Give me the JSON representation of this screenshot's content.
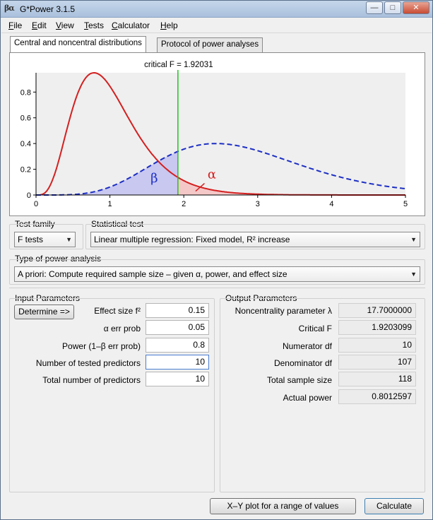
{
  "window": {
    "icon_text": "βα",
    "title": "G*Power 3.1.5",
    "minimize": "—",
    "maximize": "□",
    "close": "✕"
  },
  "menu": {
    "items": [
      {
        "mnemonic": "F",
        "rest": "ile"
      },
      {
        "mnemonic": "E",
        "rest": "dit"
      },
      {
        "mnemonic": "V",
        "rest": "iew"
      },
      {
        "mnemonic": "T",
        "rest": "ests"
      },
      {
        "mnemonic": "C",
        "rest": "alculator"
      },
      {
        "mnemonic": "H",
        "rest": "elp"
      }
    ]
  },
  "tabs": [
    {
      "label": "Central and noncentral distributions"
    },
    {
      "label": "Protocol of power analyses"
    }
  ],
  "chart_data": {
    "type": "line",
    "title": "critical F = 1.92031",
    "xlim": [
      0,
      5
    ],
    "ylim": [
      0,
      0.95
    ],
    "x_ticks": [
      "0",
      "1",
      "2",
      "3",
      "4",
      "5"
    ],
    "y_ticks": [
      "0",
      "0.2",
      "0.4",
      "0.6",
      "0.8"
    ],
    "critical_f": 1.92031,
    "series": [
      {
        "role": "central",
        "dist": "F",
        "df1": 10,
        "df2": 107,
        "color": "#d42020",
        "dash": "solid",
        "peak_x": 0.78,
        "peak_y": 0.95
      },
      {
        "role": "noncentral",
        "dist": "noncentral F",
        "df1": 10,
        "df2": 107,
        "lambda": 17.7,
        "color": "#1c2ec4",
        "dash": "dashed",
        "peak_x": 2.45,
        "peak_y": 0.4
      }
    ],
    "annotations": {
      "beta": "β",
      "alpha": "α"
    },
    "colors": {
      "critical_line": "#22c322",
      "beta_fill": "#c8c8f0",
      "alpha_fill": "#f5c8c8",
      "plot_bg": "#efefef"
    }
  },
  "test_family": {
    "label": "Test family",
    "value": "F tests"
  },
  "statistical_test": {
    "label": "Statistical test",
    "value": "Linear multiple regression: Fixed model, R² increase"
  },
  "analysis_type": {
    "label": "Type of power analysis",
    "value": "A priori: Compute required sample size – given α, power, and effect size"
  },
  "input": {
    "label": "Input Parameters",
    "determine": "Determine =>",
    "params": [
      {
        "label": "Effect size f²",
        "value": "0.15"
      },
      {
        "label": "α err prob",
        "value": "0.05"
      },
      {
        "label": "Power (1–β err prob)",
        "value": "0.8"
      },
      {
        "label": "Number of tested predictors",
        "value": "10"
      },
      {
        "label": "Total number of predictors",
        "value": "10"
      }
    ]
  },
  "output": {
    "label": "Output Parameters",
    "params": [
      {
        "label": "Noncentrality parameter λ",
        "value": "17.7000000"
      },
      {
        "label": "Critical F",
        "value": "1.9203099"
      },
      {
        "label": "Numerator df",
        "value": "10"
      },
      {
        "label": "Denominator df",
        "value": "107"
      },
      {
        "label": "Total sample size",
        "value": "118"
      },
      {
        "label": "Actual power",
        "value": "0.8012597"
      }
    ]
  },
  "buttons": {
    "xy_plot": "X–Y plot for a range of values",
    "calculate": "Calculate"
  }
}
